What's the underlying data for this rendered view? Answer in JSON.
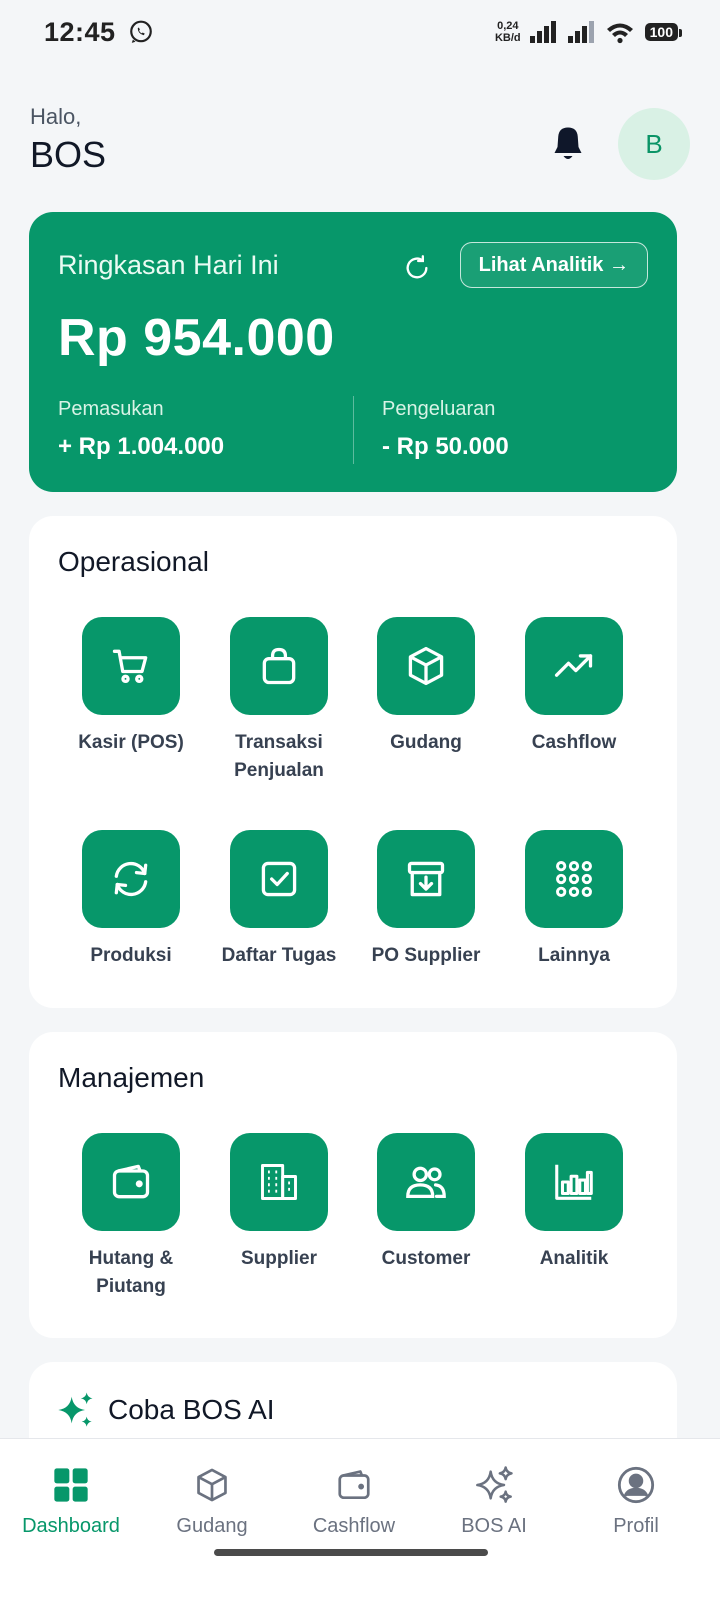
{
  "status_bar": {
    "time": "12:45",
    "net_speed_value": "0,24",
    "net_speed_unit": "KB/d",
    "battery": "100"
  },
  "header": {
    "greeting": "Halo,",
    "username": "BOS",
    "avatar_initial": "B"
  },
  "summary": {
    "title": "Ringkasan Hari Ini",
    "analytics_button": "Lihat Analitik →",
    "amount": "Rp 954.000",
    "income_label": "Pemasukan",
    "income_value": "+ Rp 1.004.000",
    "expense_label": "Pengeluaran",
    "expense_value": "- Rp 50.000"
  },
  "operasional": {
    "title": "Operasional",
    "items": [
      {
        "label": "Kasir (POS)",
        "icon": "cart-icon"
      },
      {
        "label": "Transaksi Penjualan",
        "icon": "shopping-bag-icon"
      },
      {
        "label": "Gudang",
        "icon": "box-icon"
      },
      {
        "label": "Cashflow",
        "icon": "trending-up-icon"
      },
      {
        "label": "Produksi",
        "icon": "cycle-icon"
      },
      {
        "label": "Daftar Tugas",
        "icon": "checkbox-icon"
      },
      {
        "label": "PO Supplier",
        "icon": "archive-icon"
      },
      {
        "label": "Lainnya",
        "icon": "grid-dots-icon"
      }
    ]
  },
  "manajemen": {
    "title": "Manajemen",
    "items": [
      {
        "label": "Hutang & Piutang",
        "icon": "wallet-icon"
      },
      {
        "label": "Supplier",
        "icon": "building-icon"
      },
      {
        "label": "Customer",
        "icon": "users-icon"
      },
      {
        "label": "Analitik",
        "icon": "bar-chart-icon"
      }
    ]
  },
  "ai_promo": {
    "title": "Coba BOS AI",
    "icon": "sparkle-icon"
  },
  "bottom_nav": [
    {
      "label": "Dashboard",
      "icon": "dashboard-icon",
      "active": true
    },
    {
      "label": "Gudang",
      "icon": "box-icon"
    },
    {
      "label": "Cashflow",
      "icon": "wallet-icon"
    },
    {
      "label": "BOS AI",
      "icon": "sparkle-icon"
    },
    {
      "label": "Profil",
      "icon": "profile-icon"
    }
  ],
  "colors": {
    "primary": "#07976a",
    "background": "#f4f6f8",
    "avatar_bg": "#d9f1e5"
  }
}
